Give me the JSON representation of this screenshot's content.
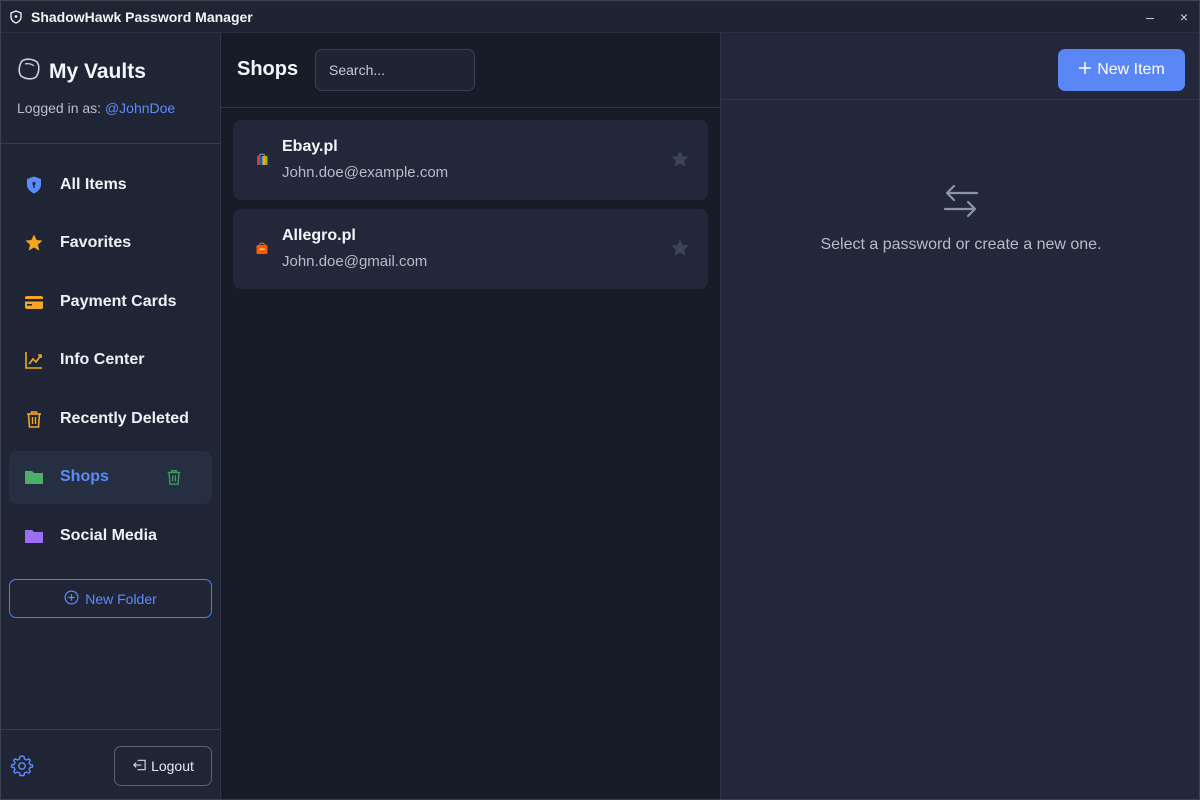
{
  "window": {
    "title": "ShadowHawk Password Manager",
    "minimize_label": "–",
    "close_label": "×"
  },
  "sidebar": {
    "vault_title": "My Vaults",
    "logged_in_label": "Logged in as:",
    "username": "@JohnDoe",
    "items": [
      {
        "label": "All Items",
        "icon": "shield-icon",
        "color": "#5b8cff"
      },
      {
        "label": "Favorites",
        "icon": "star-icon",
        "color": "#f5a524"
      },
      {
        "label": "Payment Cards",
        "icon": "credit-card-icon",
        "color": "#f5a524"
      },
      {
        "label": "Info Center",
        "icon": "trend-chart-icon",
        "color": "#f5a524"
      },
      {
        "label": "Recently Deleted",
        "icon": "trash-icon",
        "color": "#f5a524"
      },
      {
        "label": "Shops",
        "icon": "folder-icon",
        "color": "#4caf6a",
        "active": true
      },
      {
        "label": "Social Media",
        "icon": "folder-icon",
        "color": "#9b6ff2"
      }
    ],
    "new_folder_label": "New Folder",
    "logout_label": "Logout"
  },
  "list": {
    "title": "Shops",
    "search_placeholder": "Search...",
    "items": [
      {
        "name": "Ebay.pl",
        "email": "John.doe@example.com",
        "icon": "ebay-logo-icon"
      },
      {
        "name": "Allegro.pl",
        "email": "John.doe@gmail.com",
        "icon": "allegro-logo-icon"
      }
    ]
  },
  "detail": {
    "new_item_label": "New Item",
    "empty_text": "Select a password or create a new one."
  },
  "colors": {
    "accent": "#5b8cff",
    "primary_button": "#5b86f6",
    "favorites": "#f5a524",
    "shops_folder": "#4caf6a",
    "social_folder": "#9b6ff2"
  }
}
